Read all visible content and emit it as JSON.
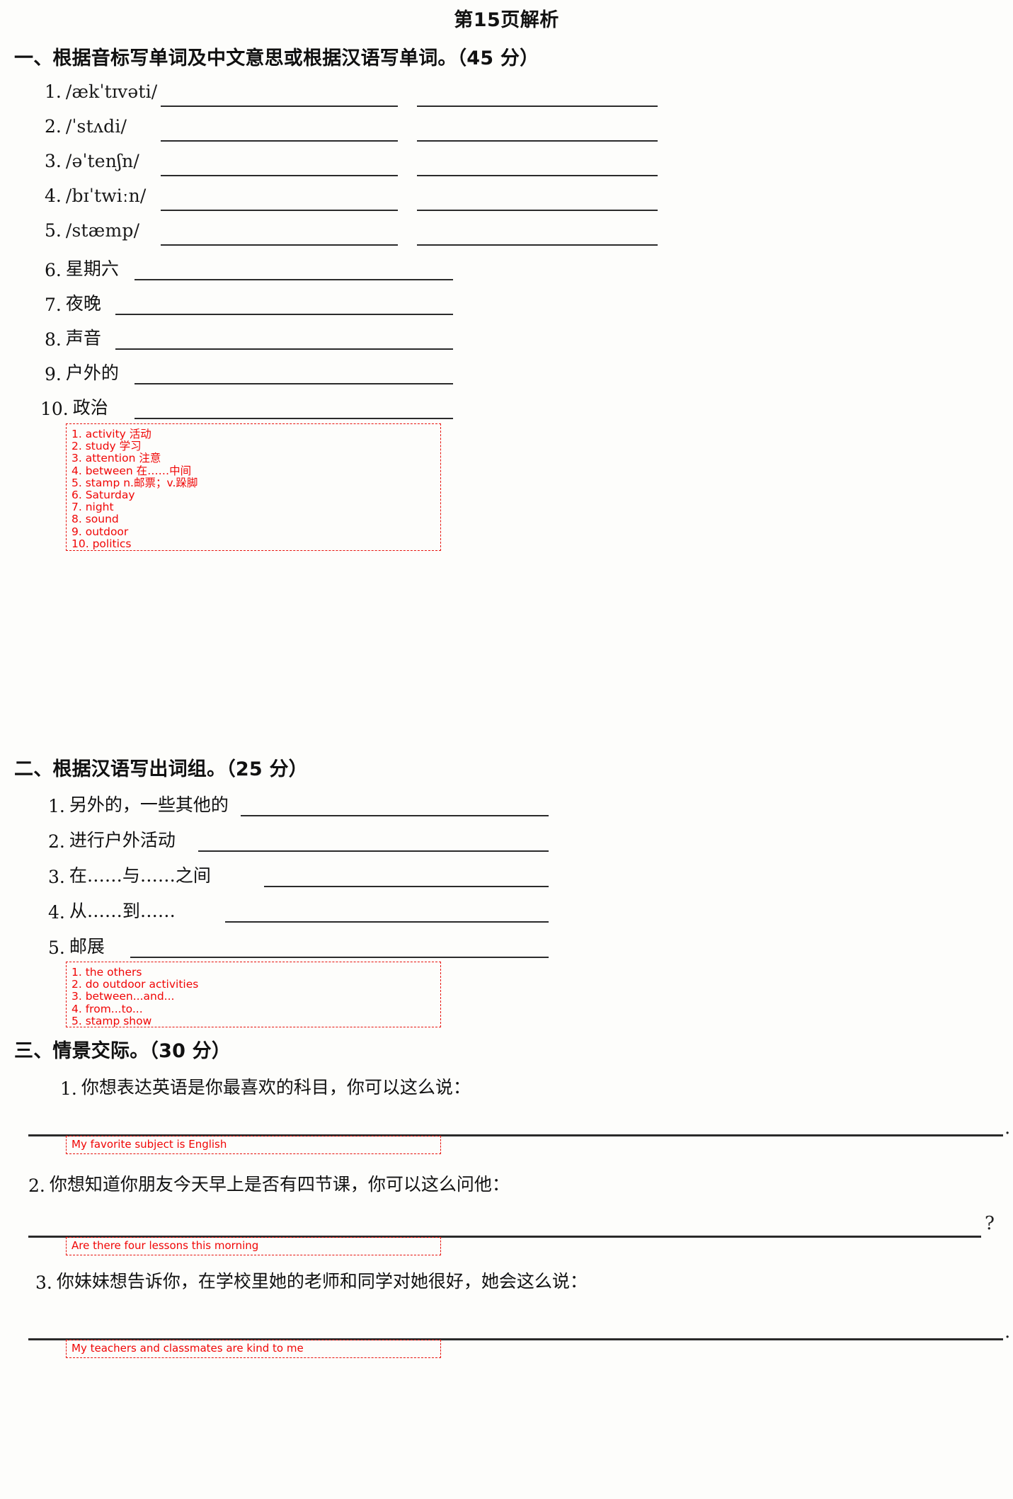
{
  "document": {
    "title": "第15页解析"
  },
  "sections": [
    {
      "heading": "一、根据音标写单词及中文意思或根据汉语写单词。（45 分）",
      "items": [
        {
          "num": "1.",
          "prompt": "/ækˈtɪvəti/",
          "type": "ipa"
        },
        {
          "num": "2.",
          "prompt": "/ˈstʌdi/",
          "type": "ipa"
        },
        {
          "num": "3.",
          "prompt": "/əˈtenʃn/",
          "type": "ipa"
        },
        {
          "num": "4.",
          "prompt": "/bɪˈtwiːn/",
          "type": "ipa"
        },
        {
          "num": "5.",
          "prompt": "/stæmp/",
          "type": "ipa"
        },
        {
          "num": "6.",
          "prompt": "星期六",
          "type": "cn"
        },
        {
          "num": "7.",
          "prompt": "夜晚",
          "type": "cn"
        },
        {
          "num": "8.",
          "prompt": "声音",
          "type": "cn"
        },
        {
          "num": "9.",
          "prompt": "户外的",
          "type": "cn"
        },
        {
          "num": "10.",
          "prompt": "政治",
          "type": "cn"
        }
      ],
      "answers": [
        "1. activity 活动",
        "2. study 学习",
        "3. attention 注意",
        "4. between 在……中间",
        "5. stamp n.邮票；v.跺脚",
        "6. Saturday",
        "7. night",
        "8. sound",
        "9. outdoor",
        "10. politics"
      ]
    },
    {
      "heading": "二、根据汉语写出词组。（25 分）",
      "items": [
        {
          "num": "1.",
          "prompt": "另外的，一些其他的"
        },
        {
          "num": "2.",
          "prompt": "进行户外活动"
        },
        {
          "num": "3.",
          "prompt": "在……与……之间"
        },
        {
          "num": "4.",
          "prompt": "从……到……"
        },
        {
          "num": "5.",
          "prompt": "邮展"
        }
      ],
      "answers": [
        "1. the others",
        "2. do outdoor activities",
        "3. between...and...",
        "4. from...to...",
        "5. stamp show"
      ]
    },
    {
      "heading": "三、情景交际。（30 分）",
      "items": [
        {
          "num": "1.",
          "prompt": "你想表达英语是你最喜欢的科目，你可以这么说：",
          "endmark": ".",
          "answer": "My favorite subject is English"
        },
        {
          "num": "2.",
          "prompt": "你想知道你朋友今天早上是否有四节课，你可以这么问他：",
          "endmark": "?",
          "answer": "Are there four lessons this morning"
        },
        {
          "num": "3.",
          "prompt": "你妹妹想告诉你，在学校里她的老师和同学对她很好，她会这么说：",
          "endmark": ".",
          "answer": "My teachers and classmates are kind to me"
        }
      ]
    }
  ],
  "colors": {
    "answer_red": "#f00606",
    "ink": "#1a1a1a",
    "rule": "#2b2b2b"
  }
}
